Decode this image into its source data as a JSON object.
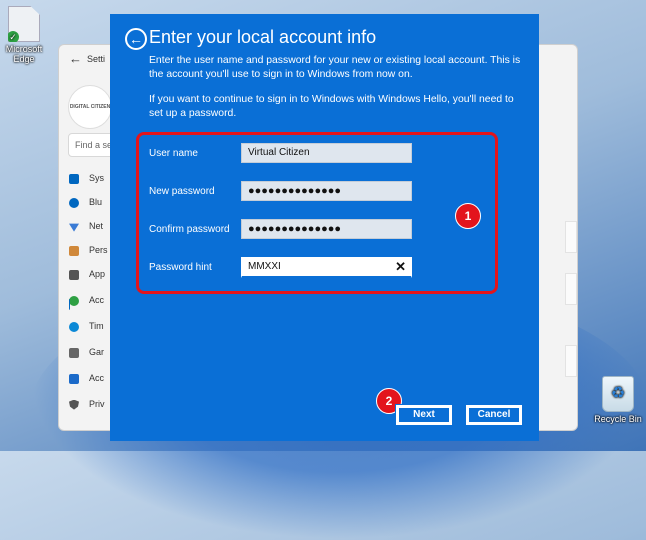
{
  "desktop": {
    "edge_icon_label": "Microsoft Edge",
    "recycle_bin_label": "Recycle Bin"
  },
  "settings_window": {
    "title": "Setti",
    "avatar_text": "DIGITAL CITIZEN",
    "search_placeholder": "Find a se",
    "nav": [
      {
        "label": "Sys",
        "icon": "monitor-icon",
        "color": "#0067c0"
      },
      {
        "label": "Blu",
        "icon": "bluetooth-icon",
        "color": "#0067c0"
      },
      {
        "label": "Net",
        "icon": "wifi-icon",
        "color": "#3a7bd5"
      },
      {
        "label": "Pers",
        "icon": "brush-icon",
        "color": "#d0883a"
      },
      {
        "label": "App",
        "icon": "apps-icon",
        "color": "#555"
      },
      {
        "label": "Acc",
        "icon": "person-icon",
        "color": "#2ea043"
      },
      {
        "label": "Tim",
        "icon": "clock-icon",
        "color": "#0a88d6"
      },
      {
        "label": "Gar",
        "icon": "gamepad-icon",
        "color": "#666"
      },
      {
        "label": "Acc",
        "icon": "accessibility-icon",
        "color": "#1b6ac9"
      },
      {
        "label": "Priv",
        "icon": "shield-icon",
        "color": "#555"
      }
    ]
  },
  "dialog": {
    "title": "Enter your local account info",
    "description": "Enter the user name and password for your new or existing local account. This is the account you'll use to sign in to Windows from now on.",
    "hello_note": "If you want to continue to sign in to Windows with Windows Hello, you'll need to set up a password.",
    "fields": {
      "user_name": {
        "label": "User name",
        "value": "Virtual Citizen"
      },
      "new_password": {
        "label": "New password",
        "value": "●●●●●●●●●●●●●●"
      },
      "confirm_password": {
        "label": "Confirm password",
        "value": "●●●●●●●●●●●●●●"
      },
      "password_hint": {
        "label": "Password hint",
        "value": "MMXXI"
      }
    },
    "next_label": "Next",
    "cancel_label": "Cancel",
    "badge_1": "1",
    "badge_2": "2"
  },
  "colors": {
    "dialog_bg": "#0a6fd6",
    "highlight": "#e3141c"
  }
}
